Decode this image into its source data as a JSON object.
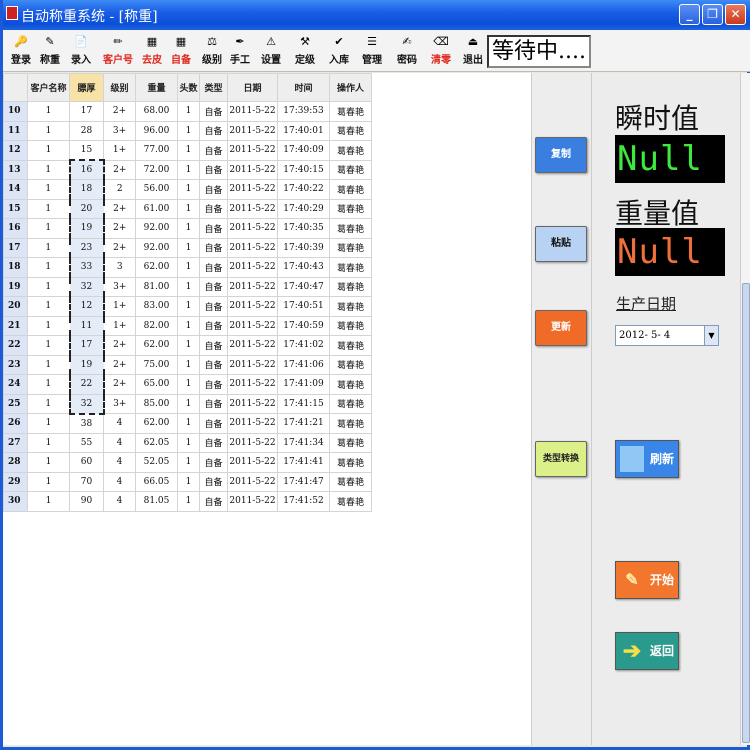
{
  "window": {
    "title": "自动称重系统 - [称重]"
  },
  "title_buttons": {
    "minimize": "_",
    "restore": "❐",
    "close": "✕"
  },
  "toolbar": {
    "items": [
      {
        "label": "登录",
        "icon": "key-icon",
        "glyph": "🔑",
        "red": false
      },
      {
        "label": "称重",
        "icon": "palette-icon",
        "glyph": "✎",
        "red": false
      },
      {
        "label": "录入",
        "icon": "document-icon",
        "glyph": "📄",
        "red": false
      },
      {
        "label": "客户号",
        "icon": "pen-icon",
        "glyph": "✏",
        "red": true
      },
      {
        "label": "去皮",
        "icon": "grid-icon",
        "glyph": "▦",
        "red": true
      },
      {
        "label": "自备",
        "icon": "grid2-icon",
        "glyph": "▦",
        "red": true
      },
      {
        "label": "级别",
        "icon": "scale-icon",
        "glyph": "⚖",
        "red": false
      },
      {
        "label": "手工",
        "icon": "pin-icon",
        "glyph": "✒",
        "red": false
      },
      {
        "label": "设置",
        "icon": "warning-icon",
        "glyph": "⚠",
        "red": false
      },
      {
        "label": "定级",
        "icon": "hammer-icon",
        "glyph": "⚒",
        "red": false
      },
      {
        "label": "入库",
        "icon": "check-icon",
        "glyph": "✔",
        "red": false
      },
      {
        "label": "管理",
        "icon": "list-icon",
        "glyph": "☰",
        "red": false
      },
      {
        "label": "密码",
        "icon": "pen2-icon",
        "glyph": "✍",
        "red": false
      },
      {
        "label": "清零",
        "icon": "clear-icon",
        "glyph": "⌫",
        "red": true
      },
      {
        "label": "退出",
        "icon": "exit-icon",
        "glyph": "⏏",
        "red": false
      }
    ],
    "status": "等待中...."
  },
  "table": {
    "headers": [
      "客户名称",
      "膘厚",
      "级别",
      "重量",
      "头数",
      "类型",
      "日期",
      "时间",
      "操作人"
    ],
    "rows": [
      {
        "n": "10",
        "c": [
          "1",
          "17",
          "2+",
          "68.00",
          "1",
          "自备",
          "2011-5-22",
          "17:39:53",
          "葛春艳"
        ]
      },
      {
        "n": "11",
        "c": [
          "1",
          "28",
          "3+",
          "96.00",
          "1",
          "自备",
          "2011-5-22",
          "17:40:01",
          "葛春艳"
        ]
      },
      {
        "n": "12",
        "c": [
          "1",
          "15",
          "1+",
          "77.00",
          "1",
          "自备",
          "2011-5-22",
          "17:40:09",
          "葛春艳"
        ]
      },
      {
        "n": "13",
        "c": [
          "1",
          "16",
          "2+",
          "72.00",
          "1",
          "自备",
          "2011-5-22",
          "17:40:15",
          "葛春艳"
        ]
      },
      {
        "n": "14",
        "c": [
          "1",
          "18",
          "2",
          "56.00",
          "1",
          "自备",
          "2011-5-22",
          "17:40:22",
          "葛春艳"
        ]
      },
      {
        "n": "15",
        "c": [
          "1",
          "20",
          "2+",
          "61.00",
          "1",
          "自备",
          "2011-5-22",
          "17:40:29",
          "葛春艳"
        ]
      },
      {
        "n": "16",
        "c": [
          "1",
          "19",
          "2+",
          "92.00",
          "1",
          "自备",
          "2011-5-22",
          "17:40:35",
          "葛春艳"
        ]
      },
      {
        "n": "17",
        "c": [
          "1",
          "23",
          "2+",
          "92.00",
          "1",
          "自备",
          "2011-5-22",
          "17:40:39",
          "葛春艳"
        ]
      },
      {
        "n": "18",
        "c": [
          "1",
          "33",
          "3",
          "62.00",
          "1",
          "自备",
          "2011-5-22",
          "17:40:43",
          "葛春艳"
        ]
      },
      {
        "n": "19",
        "c": [
          "1",
          "32",
          "3+",
          "81.00",
          "1",
          "自备",
          "2011-5-22",
          "17:40:47",
          "葛春艳"
        ]
      },
      {
        "n": "20",
        "c": [
          "1",
          "12",
          "1+",
          "83.00",
          "1",
          "自备",
          "2011-5-22",
          "17:40:51",
          "葛春艳"
        ]
      },
      {
        "n": "21",
        "c": [
          "1",
          "11",
          "1+",
          "82.00",
          "1",
          "自备",
          "2011-5-22",
          "17:40:59",
          "葛春艳"
        ]
      },
      {
        "n": "22",
        "c": [
          "1",
          "17",
          "2+",
          "62.00",
          "1",
          "自备",
          "2011-5-22",
          "17:41:02",
          "葛春艳"
        ]
      },
      {
        "n": "23",
        "c": [
          "1",
          "19",
          "2+",
          "75.00",
          "1",
          "自备",
          "2011-5-22",
          "17:41:06",
          "葛春艳"
        ]
      },
      {
        "n": "24",
        "c": [
          "1",
          "22",
          "2+",
          "65.00",
          "1",
          "自备",
          "2011-5-22",
          "17:41:09",
          "葛春艳"
        ]
      },
      {
        "n": "25",
        "c": [
          "1",
          "32",
          "3+",
          "85.00",
          "1",
          "自备",
          "2011-5-22",
          "17:41:15",
          "葛春艳"
        ]
      },
      {
        "n": "26",
        "c": [
          "1",
          "38",
          "4",
          "62.00",
          "1",
          "自备",
          "2011-5-22",
          "17:41:21",
          "葛春艳"
        ]
      },
      {
        "n": "27",
        "c": [
          "1",
          "55",
          "4",
          "62.05",
          "1",
          "自备",
          "2011-5-22",
          "17:41:34",
          "葛春艳"
        ]
      },
      {
        "n": "28",
        "c": [
          "1",
          "60",
          "4",
          "52.05",
          "1",
          "自备",
          "2011-5-22",
          "17:41:41",
          "葛春艳"
        ]
      },
      {
        "n": "29",
        "c": [
          "1",
          "70",
          "4",
          "66.05",
          "1",
          "自备",
          "2011-5-22",
          "17:41:47",
          "葛春艳"
        ]
      },
      {
        "n": "30",
        "c": [
          "1",
          "90",
          "4",
          "81.05",
          "1",
          "自备",
          "2011-5-22",
          "17:41:52",
          "葛春艳"
        ]
      }
    ],
    "selected_column": 1,
    "selected_rows": [
      "13",
      "25"
    ]
  },
  "side_buttons": {
    "copy": "复制",
    "paste": "粘贴",
    "update": "更新",
    "convert": "类型转换"
  },
  "readout": {
    "instant_label": "瞬时值",
    "instant_value": "Null",
    "weight_label": "重量值",
    "weight_value": "Null"
  },
  "production_date": {
    "label": "生产日期",
    "value": "2012- 5- 4",
    "arrow": "▼"
  },
  "actions": {
    "refresh": "刷新",
    "start": "开始",
    "back": "返回"
  },
  "colors": {
    "titlebar": "#1a5ee6",
    "instant_text": "#3ee83e",
    "weight_text": "#f0703a",
    "copy_btn": "#3a7fe0",
    "paste_btn": "#b8d2f4",
    "update_btn": "#f06a28",
    "convert_btn": "#dcf08a",
    "refresh_btn": "#3a86e8",
    "start_btn": "#f2762e",
    "back_btn": "#2a9a8c"
  }
}
